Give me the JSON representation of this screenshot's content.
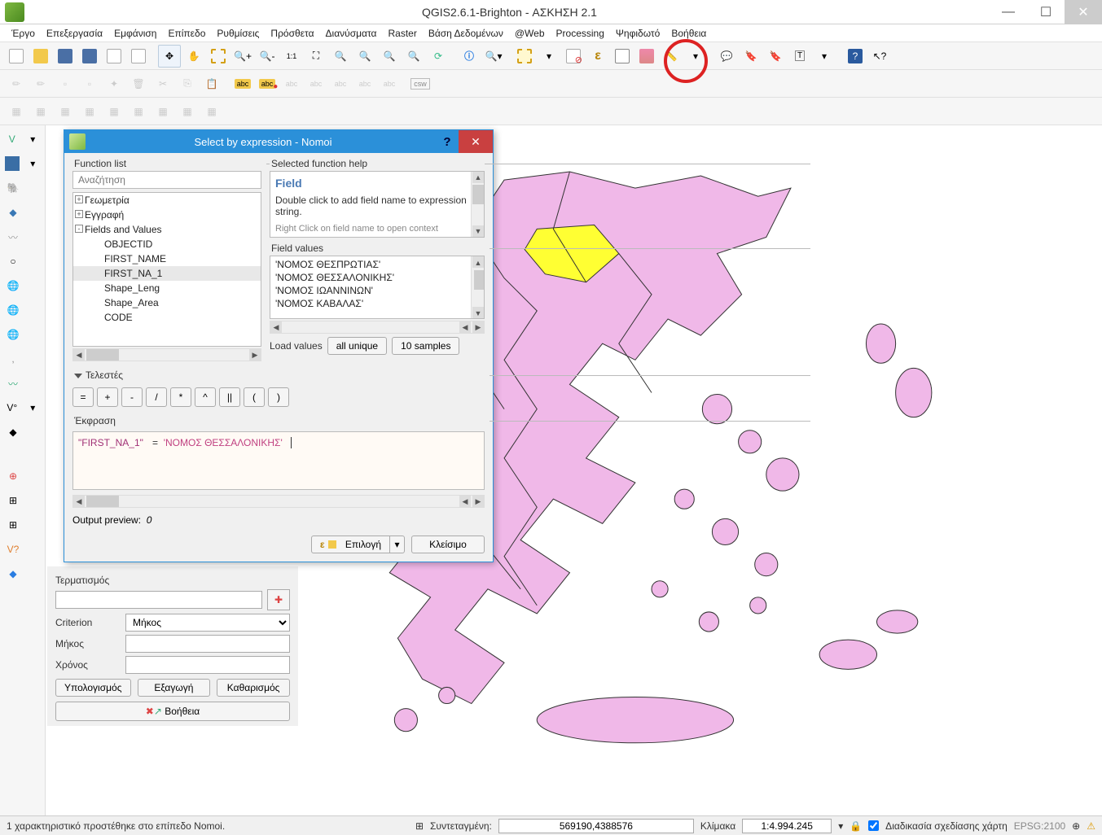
{
  "window": {
    "title": "QGIS2.6.1-Brighton - ΑΣΚΗΣΗ 2.1"
  },
  "menu": [
    "Έργο",
    "Επεξεργασία",
    "Εμφάνιση",
    "Επίπεδο",
    "Ρυθμίσεις",
    "Πρόσθετα",
    "Διανύσματα",
    "Raster",
    "Βάση Δεδομένων",
    "@Web",
    "Processing",
    "Ψηφιδωτό",
    "Βοήθεια"
  ],
  "dialog": {
    "title": "Select by expression - Nomoi",
    "function_list_label": "Function list",
    "selected_help_label": "Selected function help",
    "search_placeholder": "Αναζήτηση",
    "tree": {
      "roots": [
        {
          "label": "Γεωμετρία",
          "expanded": false
        },
        {
          "label": "Εγγραφή",
          "expanded": false
        },
        {
          "label": "Fields and Values",
          "expanded": true,
          "children": [
            "OBJECTID",
            "FIRST_NAME",
            "FIRST_NA_1",
            "Shape_Leng",
            "Shape_Area",
            "CODE"
          ]
        }
      ],
      "selected": "FIRST_NA_1"
    },
    "help": {
      "title": "Field",
      "body": "Double click to add field name to expression string.",
      "more": "Right Click on field name to open context"
    },
    "field_values_label": "Field values",
    "field_values": [
      "'ΝΟΜΟΣ ΘΕΣΠΡΩΤΙΑΣ'",
      "'ΝΟΜΟΣ ΘΕΣΣΑΛΟΝΙΚΗΣ'",
      "'ΝΟΜΟΣ ΙΩΑΝΝΙΝΩΝ'",
      "'ΝΟΜΟΣ ΚΑΒΑΛΑΣ'"
    ],
    "load_values_label": "Load values",
    "all_unique_label": "all unique",
    "samples_label": "10 samples",
    "operators_label": "Τελεστές",
    "operators": [
      "=",
      "+",
      "-",
      "/",
      "*",
      "^",
      "||",
      "(",
      ")"
    ],
    "expression_label": "Έκφραση",
    "expression": {
      "field": "\"FIRST_NA_1\"",
      "op": "=",
      "value": "'ΝΟΜΟΣ ΘΕΣΣΑΛΟΝΙΚΗΣ'"
    },
    "output_preview_label": "Output preview:",
    "output_preview_value": "0",
    "select_label": "Επιλογή",
    "close_label": "Κλείσιμο"
  },
  "bottom_panel": {
    "termination_label": "Τερματισμός",
    "criterion_label": "Criterion",
    "criterion_value": "Μήκος",
    "length_label": "Μήκος",
    "time_label": "Χρόνος",
    "calc_label": "Υπολογισμός",
    "export_label": "Εξαγωγή",
    "clear_label": "Καθαρισμός",
    "help_label": "Βοήθεια"
  },
  "statusbar": {
    "message": "1 χαρακτηριστικό προστέθηκε στο επίπεδο Nomoi.",
    "coord_label": "Συντεταγμένη:",
    "coord_value": "569190,4388576",
    "scale_label": "Κλίμακα",
    "scale_value": "1:4.994.245",
    "render_label": "Διαδικασία σχεδίασης χάρτη",
    "crs": "EPSG:2100"
  }
}
